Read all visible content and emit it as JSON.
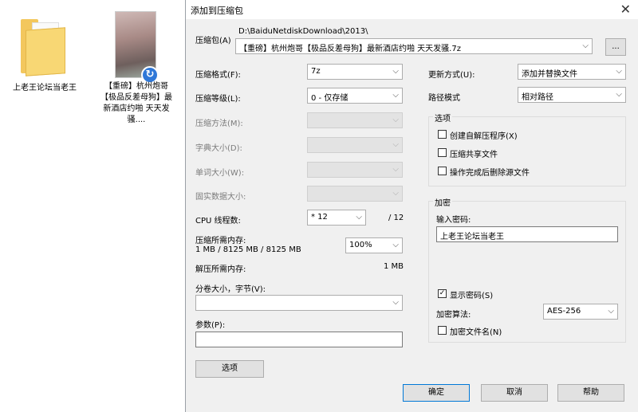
{
  "desktop": {
    "folder_label": "上老王论坛当老王",
    "file_label": "【重磅】杭州炮哥【极品反差母狗】最新酒店约啪 天天发骚....",
    "file_badge": "↻"
  },
  "dialog": {
    "title": "添加到压缩包",
    "close_glyph": "✕",
    "archive_label": "压缩包(A)",
    "archive_path": "D:\\BaiduNetdiskDownload\\2013\\",
    "archive_name": "【重磅】杭州炮哥【极品反差母狗】最新酒店约啪 天天发骚.7z",
    "browse_label": "...",
    "arrow": "⌵",
    "left": {
      "format_label": "压缩格式(F):",
      "format_value": "7z",
      "level_label": "压缩等级(L):",
      "level_value": "0 - 仅存储",
      "method_label": "压缩方法(M):",
      "dict_label": "字典大小(D):",
      "word_label": "单词大小(W):",
      "solid_label": "固实数据大小:",
      "threads_label": "CPU 线程数:",
      "threads_value": "* 12",
      "threads_total": "/ 12",
      "mem_label": "压缩所需内存:",
      "mem_value": "1 MB / 8125 MB / 8125 MB",
      "mem_percent": "100%",
      "decomp_label": "解压所需内存:",
      "decomp_value": "1 MB",
      "volume_label": "分卷大小，字节(V):",
      "params_label": "参数(P):",
      "options_button": "选项"
    },
    "right": {
      "update_label": "更新方式(U):",
      "update_value": "添加并替换文件",
      "path_label": "路径模式",
      "path_value": "相对路径",
      "options_group": "选项",
      "opt_sfx": "创建自解压程序(X)",
      "opt_shared": "压缩共享文件",
      "opt_delete": "操作完成后删除源文件",
      "encrypt_group": "加密",
      "password_label": "输入密码:",
      "password_value": "上老王论坛当老王",
      "show_password": "显示密码(S)",
      "show_password_checked": "✓",
      "enc_method_label": "加密算法:",
      "enc_method_value": "AES-256",
      "encrypt_names": "加密文件名(N)"
    },
    "buttons": {
      "ok": "确定",
      "cancel": "取消",
      "help": "帮助"
    }
  }
}
